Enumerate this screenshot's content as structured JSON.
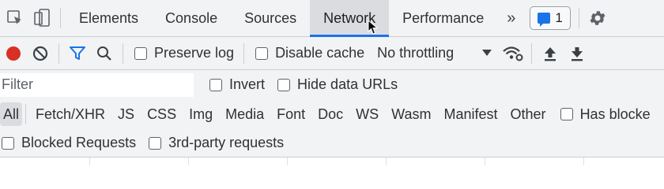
{
  "tabs": [
    {
      "label": "Elements"
    },
    {
      "label": "Console"
    },
    {
      "label": "Sources"
    },
    {
      "label": "Network",
      "active": true
    },
    {
      "label": "Performance"
    }
  ],
  "more_tabs_label": "»",
  "issues_badge": {
    "count": "1"
  },
  "toolbar": {
    "preserve_log_label": "Preserve log",
    "disable_cache_label": "Disable cache",
    "throttling_value": "No throttling"
  },
  "filter": {
    "placeholder": "Filter",
    "invert_label": "Invert",
    "hide_data_urls_label": "Hide data URLs"
  },
  "type_filters": [
    "All",
    "Fetch/XHR",
    "JS",
    "CSS",
    "Img",
    "Media",
    "Font",
    "Doc",
    "WS",
    "Wasm",
    "Manifest",
    "Other"
  ],
  "has_blocked_cookies_label": "Has blocke",
  "blocked_requests_label": "Blocked Requests",
  "third_party_label": "3rd-party requests",
  "colors": {
    "accent": "#1a73e8",
    "record": "#d93025",
    "toolbar_bg": "#f1f3f4"
  }
}
